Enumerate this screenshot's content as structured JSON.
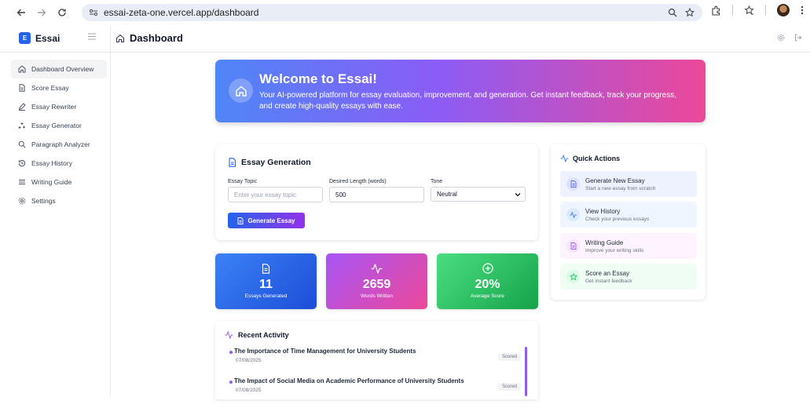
{
  "browser": {
    "url": "essai-zeta-one.vercel.app/dashboard"
  },
  "app": {
    "brand_initial": "E",
    "brand_name": "Essai",
    "page_title": "Dashboard"
  },
  "sidebar": {
    "items": [
      {
        "label": "Dashboard Overview",
        "icon": "home-icon",
        "active": true
      },
      {
        "label": "Score Essay",
        "icon": "document-icon",
        "active": false
      },
      {
        "label": "Essay Rewriter",
        "icon": "pencil-icon",
        "active": false
      },
      {
        "label": "Essay Generator",
        "icon": "sparkles-icon",
        "active": false
      },
      {
        "label": "Paragraph Analyzer",
        "icon": "search-icon",
        "active": false
      },
      {
        "label": "Essay History",
        "icon": "history-icon",
        "active": false
      },
      {
        "label": "Writing Guide",
        "icon": "list-icon",
        "active": false
      },
      {
        "label": "Settings",
        "icon": "gear-icon",
        "active": false
      }
    ]
  },
  "welcome": {
    "title": "Welcome to Essai!",
    "text": "Your AI-powered platform for essay evaluation, improvement, and generation. Get instant feedback, track your progress, and create high-quality essays with ease."
  },
  "generation": {
    "title": "Essay Generation",
    "topic_label": "Essay Topic",
    "topic_placeholder": "Enter your essay topic",
    "length_label": "Desired Length (words)",
    "length_value": "500",
    "tone_label": "Tone",
    "tone_value": "Neutral",
    "button_label": "Generate Essay"
  },
  "stats": [
    {
      "value": "11",
      "label": "Essays Generated",
      "icon": "document-icon"
    },
    {
      "value": "2659",
      "label": "Words Written",
      "icon": "activity-icon"
    },
    {
      "value": "20%",
      "label": "Average Score",
      "icon": "plus-circle-icon"
    }
  ],
  "activity": {
    "title": "Recent Activity",
    "items": [
      {
        "title": "The Importance of Time Management for University Students",
        "date": "07/08/2025",
        "badge": "Scored"
      },
      {
        "title": "The Impact of Social Media on Academic Performance of University Students",
        "date": "07/08/2025",
        "badge": "Scored"
      }
    ]
  },
  "quick_actions": {
    "title": "Quick Actions",
    "items": [
      {
        "title": "Generate New Essay",
        "desc": "Start a new essay from scratch",
        "icon": "document-icon",
        "color": "#6366f1"
      },
      {
        "title": "View History",
        "desc": "Check your previous essays",
        "icon": "activity-icon",
        "color": "#3b82f6"
      },
      {
        "title": "Writing Guide",
        "desc": "Improve your writing skills",
        "icon": "document-icon",
        "color": "#a855f7"
      },
      {
        "title": "Score an Essay",
        "desc": "Get instant feedback",
        "icon": "star-icon",
        "color": "#22c55e"
      }
    ]
  }
}
